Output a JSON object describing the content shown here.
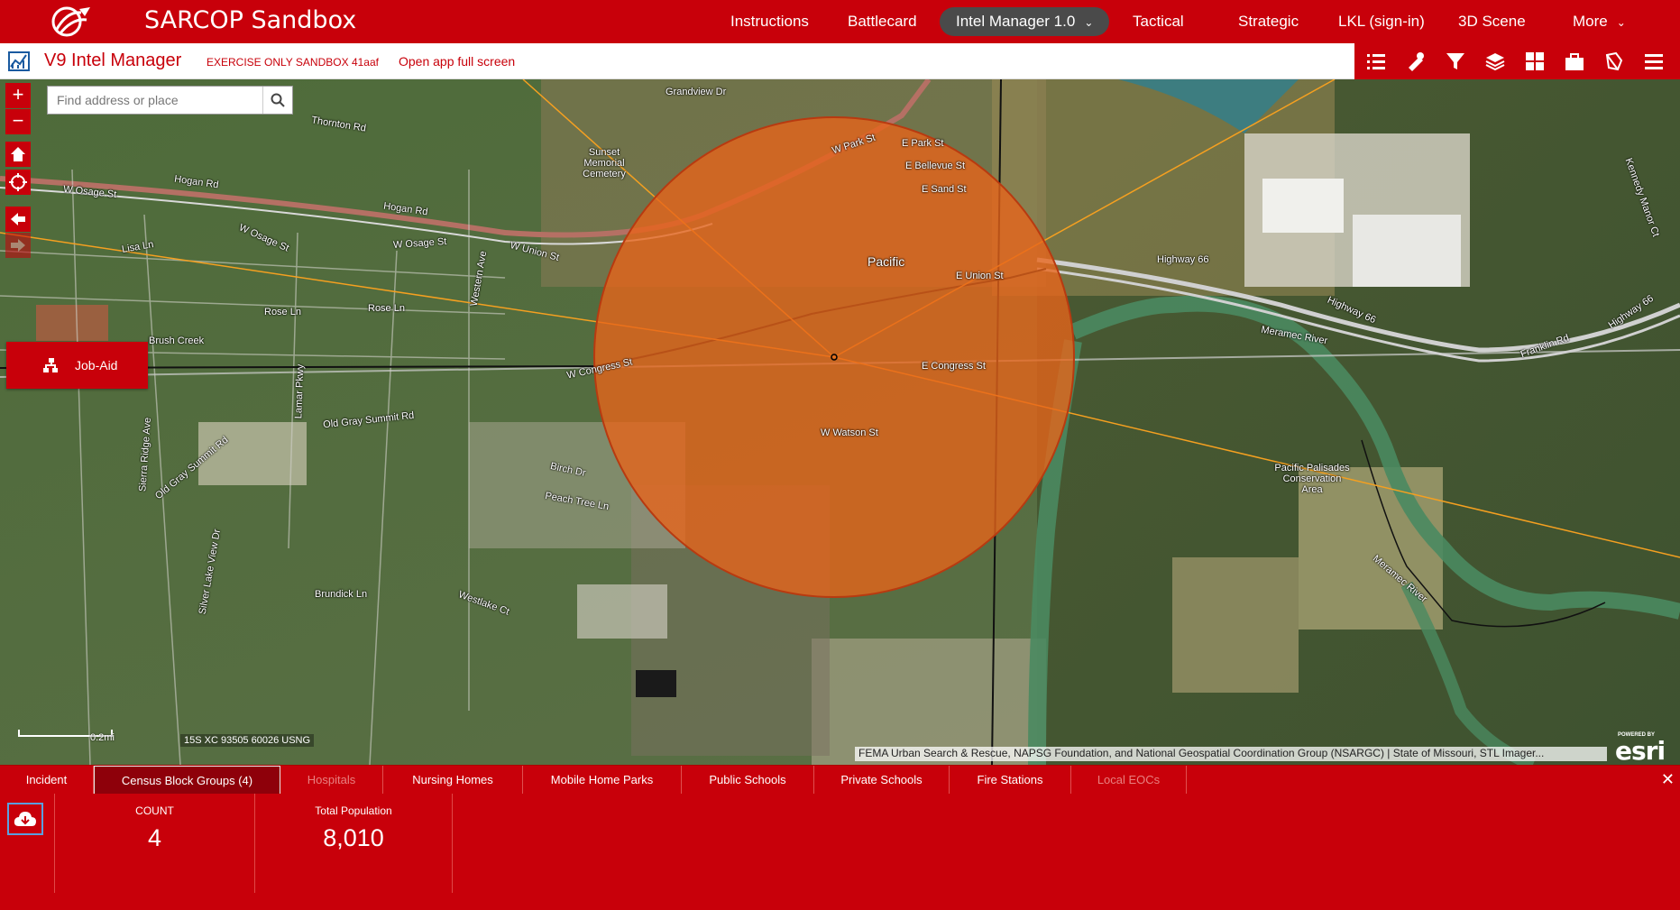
{
  "header": {
    "app_title": "SARCOP Sandbox",
    "nav": [
      {
        "label": "Instructions"
      },
      {
        "label": "Battlecard"
      },
      {
        "label": "Intel Manager 1.0"
      },
      {
        "label": "Tactical"
      },
      {
        "label": "Strategic"
      },
      {
        "label": "LKL (sign-in)"
      },
      {
        "label": "3D Scene"
      },
      {
        "label": "More"
      }
    ],
    "active_nav": "Intel Manager 1.0"
  },
  "subbar": {
    "widget_title": "V9 Intel Manager",
    "sandbox_label": "EXERCISE ONLY SANDBOX 41aaf",
    "fullscreen_link": "Open app full screen"
  },
  "toolbar": {
    "icons": [
      "list-icon",
      "measure-icon",
      "filter-icon",
      "layers-icon",
      "grid-icon",
      "briefcase-icon",
      "draw-icon",
      "menu-icon"
    ]
  },
  "map": {
    "search_placeholder": "Find address or place",
    "job_aid_label": "Job-Aid",
    "scale_label": "0.2mi",
    "coordinate": "15S XC 93505 60026 USNG",
    "attribution": "FEMA Urban Search & Rescue, NAPSG Foundation, and National Geospatial Coordination Group (NSARGC) | State of Missouri, STL Imager...",
    "esri_powered": "POWERED BY",
    "esri_logo": "esri",
    "labels": {
      "thornton_rd": "Thornton Rd",
      "hogan_rd_1": "Hogan Rd",
      "hogan_rd_2": "Hogan Rd",
      "w_osage_st_1": "W Osage St",
      "w_osage_st_2": "W Osage St",
      "w_osage_st_3": "W Osage St",
      "w_union_st": "W Union St",
      "lisa_ln": "Lisa Ln",
      "rose_ln_1": "Rose Ln",
      "rose_ln_2": "Rose Ln",
      "pacific": "Pacific",
      "w_park_st": "W Park St",
      "e_park_st": "E Park St",
      "e_bellevue_st": "E Bellevue St",
      "e_sand_st": "E Sand St",
      "e_union_st": "E Union St",
      "e_congress_st": "E Congress St",
      "w_congress_st": "W Congress St",
      "w_watson_st": "W Watson St",
      "highway_66_1": "Highway 66",
      "highway_66_2": "Highway 66",
      "highway_66_3": "Highway 66",
      "franklin_rd": "Franklin Rd",
      "meramec_river_1": "Meramec River",
      "meramec_river_2": "Meramec River",
      "old_gray_summit_rd_1": "Old Gray Summit Rd",
      "old_gray_summit_rd_2": "Old Gray Summit Rd",
      "birch_dr": "Birch Dr",
      "peach_tree_ln": "Peach Tree Ln",
      "brundick_ln": "Brundick Ln",
      "westlake_ct": "Westlake Ct",
      "grandview_dr": "Grandview Dr",
      "sunset_cemetery": "Sunset Memorial Cemetery",
      "pacific_palisades": "Pacific Palisades Conservation Area",
      "brush_creek": "Brush Creek",
      "lamar_pkwy": "Lamar Pkwy",
      "western_ave": "Western Ave",
      "sierra_ridge_ave": "Sierra Ridge Ave",
      "silver_lake_view_dr": "Silver Lake View Dr",
      "kennedy_manor_ct": "Kennedy Manor Ct"
    }
  },
  "tabs": [
    {
      "label": "Incident",
      "state": "normal"
    },
    {
      "label": "Census Block Groups (4)",
      "state": "active"
    },
    {
      "label": "Hospitals",
      "state": "disabled"
    },
    {
      "label": "Nursing Homes",
      "state": "normal"
    },
    {
      "label": "Mobile Home Parks",
      "state": "normal"
    },
    {
      "label": "Public Schools",
      "state": "normal"
    },
    {
      "label": "Private Schools",
      "state": "normal"
    },
    {
      "label": "Fire Stations",
      "state": "normal"
    },
    {
      "label": "Local EOCs",
      "state": "disabled"
    }
  ],
  "panel": {
    "close_glyph": "✕",
    "stats": [
      {
        "label": "COUNT",
        "value": "4"
      },
      {
        "label": "Total Population",
        "value": "8,010"
      }
    ]
  },
  "colors": {
    "brand_red": "#c8000a",
    "active_tab": "#8e000a",
    "buffer_fill": "#e8641a",
    "buffer_stroke": "#b83a10",
    "sector_line": "#f5a020"
  }
}
